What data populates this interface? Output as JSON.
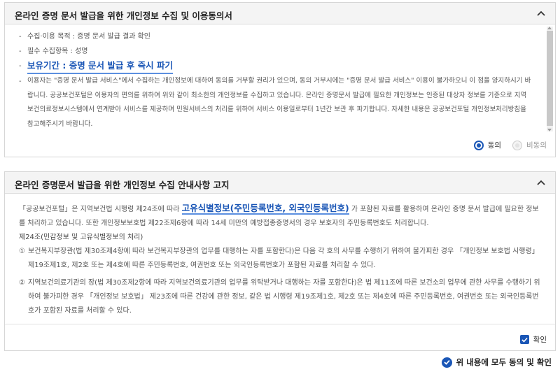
{
  "panel1": {
    "title": "온라인 증명 문서 발급을 위한 개인정보 수집 및 이용동의서",
    "items": [
      {
        "dash": "-",
        "text": "수집·이용 목적 : 증명 문서 발급 결과 확인"
      },
      {
        "dash": "-",
        "text": "필수 수집항목 : 성명"
      },
      {
        "dash": "-",
        "text": "보유기간 : 증명 문서 발급 후 즉시 파기"
      },
      {
        "dash": "-",
        "text": "이용자는 \"증명 문서 발급 서비스\"에서 수집하는 개인정보에 대하여 동의를 거부할 권리가 있으며, 동의 거부시에는 \"증명 문서 발급 서비스\" 이용이 불가하오니 이 점을 양지하시기 바랍니다. 공공보건포털은 이용자의 편의를 위하여 위와 같이 최소한의 개인정보를 수집하고 있습니다. 온라인 증명문서 발급에 필요한 개인정보는 인증된 대상자 정보를 기준으로 지역보건의료정보시스템에서 연계받아 서비스를 제공하며 민원서비스의 처리를 위하여 서비스 이용일로부터 1년간 보관 후 파기합니다. 자세한 내용은 공공보건포털 개인정보처리방침을 참고해주시기 바랍니다."
      }
    ],
    "agree_label": "동의",
    "disagree_label": "비동의"
  },
  "panel2": {
    "title": "온라인 증명문서 발급을 위한 개인정보 수집 안내사항 고지",
    "intro_before": "「공공보건포털」은 지역보건법 시행령 제24조에 따라 ",
    "intro_highlight": "고유식별정보(주민등록번호, 외국인등록번호)",
    "intro_after": " 가 포함된 자료를 활용하여 온라인 증명 문서 발급에 필요한 정보를 처리하고 있습니다. 또한 개인정보보호법 제22조제6항에 따라 14세 미만의 예방접종증명서의 경우 보호자의 주민등록번호도 처리합니다.",
    "section": "제24조(민감정보 및 고유식별정보의 처리)",
    "items": [
      {
        "num": "①",
        "text": "보건복지부장관(법 제30조제4항에 따라 보건복지부장관의 업무를 대행하는 자를 포함한다)은 다음 각 호의 사무를 수행하기 위하여 불가피한 경우 「개인정보 보호법 시행령」 제19조제1호, 제2호 또는 제4호에 따른 주민등록번호, 여권번호 또는 외국인등록번호가 포함된 자료를 처리할 수 있다."
      },
      {
        "num": "②",
        "text": "지역보건의료기관의 장(법 제30조제2항에 따라 지역보건의료기관의 업무를 위탁받거나 대행하는 자를 포함한다)은 법 제11조에 따른 보건소의 업무에 관한 사무를 수행하기 위하여 불가피한 경우 「개인정보 보호법」 제23조에 따른 건강에 관한 정보, 같은 법 시행령 제19조제1호, 제2호 또는 제4호에 따른 주민등록번호, 여권번호 또는 외국인등록번호가 포함된 자료를 처리할 수 있다."
      }
    ],
    "confirm_label": "확인"
  },
  "all_agree_label": "위 내용에 모두 동의 및 확인",
  "colors": {
    "accent": "#1a56b6",
    "highlight_underline": "#5b8fe0",
    "header_bg": "#f4f4f4"
  },
  "icons": {
    "collapse": "chevron-up-icon",
    "confirm": "checkmark-icon",
    "all_agree": "check-circle-icon"
  }
}
